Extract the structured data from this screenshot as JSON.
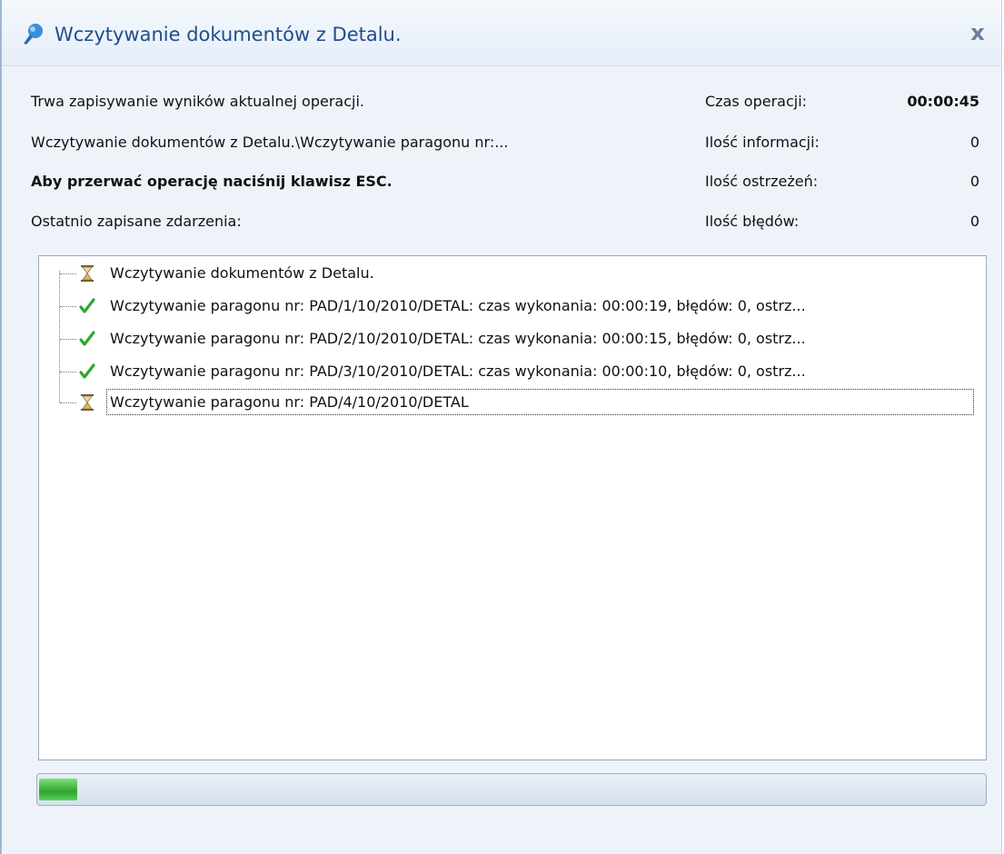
{
  "window": {
    "title": "Wczytywanie dokumentów z Detalu.",
    "close_label": "x"
  },
  "status": {
    "line1": "Trwa zapisywanie wyników aktualnej operacji.",
    "line2": "Wczytywanie dokumentów z Detalu.\\Wczytywanie paragonu nr:...",
    "line3": "Aby przerwać operację naciśnij klawisz ESC.",
    "line4": "Ostatnio zapisane zdarzenia:"
  },
  "stats": {
    "time_label": "Czas operacji:",
    "time_value": "00:00:45",
    "info_label": "Ilość informacji:",
    "info_value": "0",
    "warnings_label": "Ilość ostrzeżeń:",
    "warnings_value": "0",
    "errors_label": "Ilość błędów:",
    "errors_value": "0"
  },
  "events": [
    {
      "icon": "hourglass-icon",
      "text": "Wczytywanie dokumentów z Detalu."
    },
    {
      "icon": "checkmark-icon",
      "text": "Wczytywanie paragonu nr: PAD/1/10/2010/DETAL: czas wykonania: 00:00:19, błędów: 0, ostrz..."
    },
    {
      "icon": "checkmark-icon",
      "text": "Wczytywanie paragonu nr: PAD/2/10/2010/DETAL: czas wykonania: 00:00:15, błędów: 0, ostrz..."
    },
    {
      "icon": "checkmark-icon",
      "text": "Wczytywanie paragonu nr: PAD/3/10/2010/DETAL: czas wykonania: 00:00:10, błędów: 0, ostrz..."
    },
    {
      "icon": "hourglass-icon",
      "text": "Wczytywanie paragonu nr: PAD/4/10/2010/DETAL"
    }
  ],
  "progress": {
    "fraction": 0.04
  },
  "colors": {
    "title": "#1f4e8c",
    "progress_green": "#2ea42e",
    "check_green": "#2fa82f"
  }
}
